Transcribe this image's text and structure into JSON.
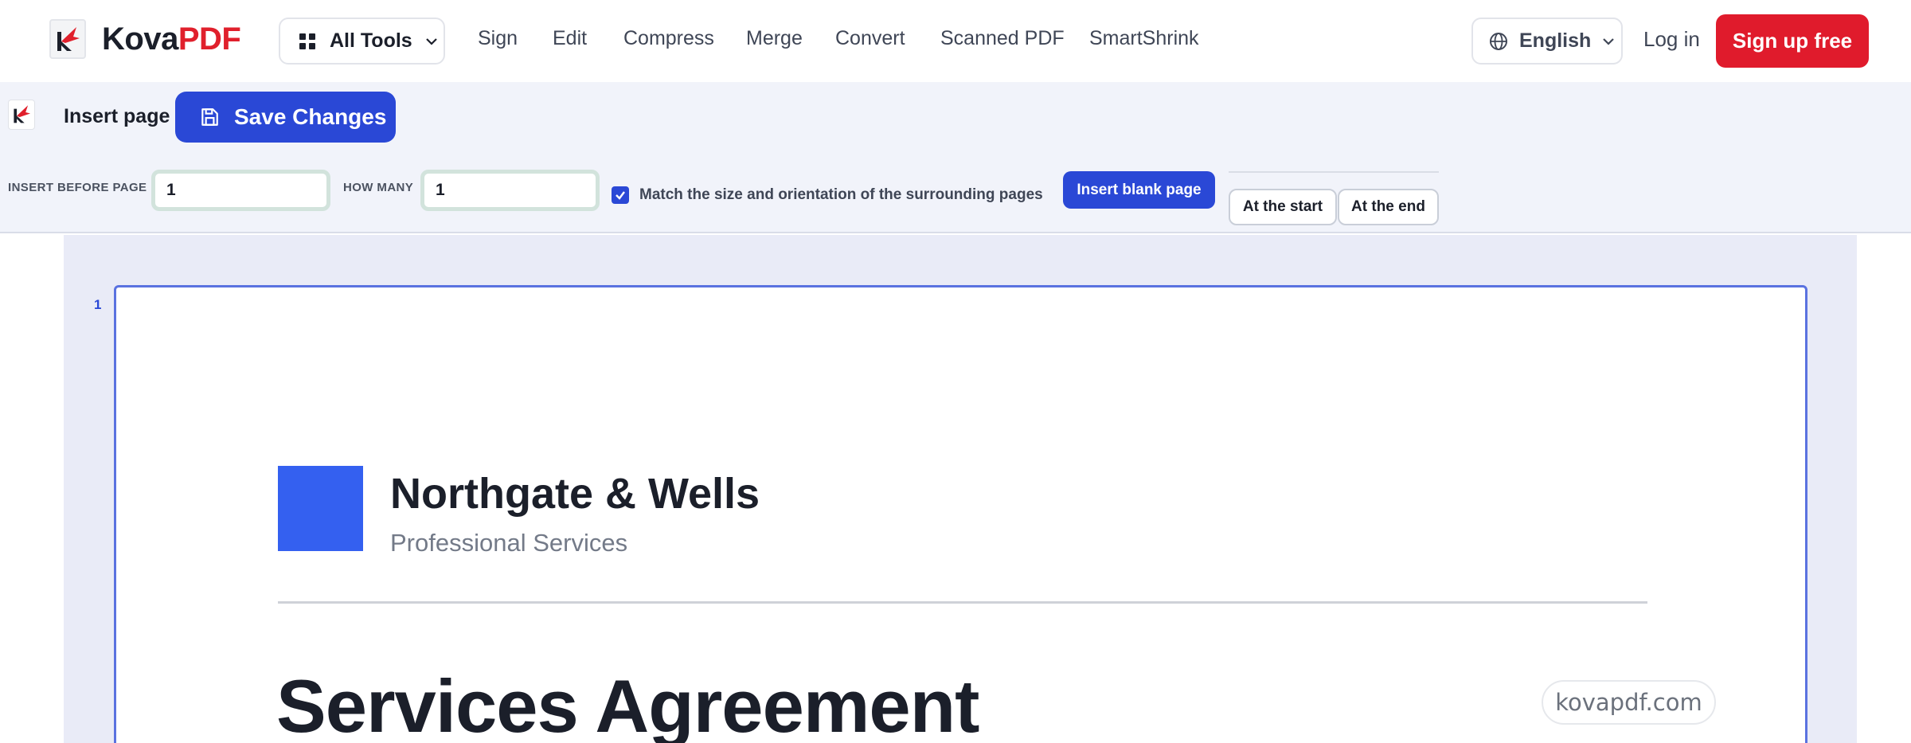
{
  "brand": {
    "name_part1": "Kova",
    "name_part2": "PDF",
    "primary_color": "#2a48d6",
    "accent_color": "#e01b2c"
  },
  "topnav": {
    "all_tools_label": "All Tools",
    "links": [
      "Sign",
      "Edit",
      "Compress",
      "Merge",
      "Convert",
      "Scanned PDF",
      "SmartShrink"
    ],
    "language_label": "English",
    "login_label": "Log in",
    "signup_label": "Sign up free"
  },
  "toolbar": {
    "title": "Insert page",
    "save_label": "Save Changes",
    "insert_before_label": "INSERT BEFORE PAGE",
    "insert_before_value": "1",
    "how_many_label": "HOW MANY",
    "how_many_value": "1",
    "match_checked": true,
    "match_label": "Match the size and orientation of the surrounding pages",
    "insert_blank_label": "Insert blank page",
    "at_start_label": "At the start",
    "at_end_label": "At the end"
  },
  "document": {
    "page_number": "1",
    "company": "Northgate & Wells",
    "subtitle": "Professional Services",
    "heading": "Services Agreement",
    "watermark": "kovapdf.com"
  },
  "icons": [
    "kovapdf-logo-icon",
    "grid-icon",
    "chevron-down-icon",
    "globe-icon",
    "save-icon",
    "check-icon"
  ]
}
